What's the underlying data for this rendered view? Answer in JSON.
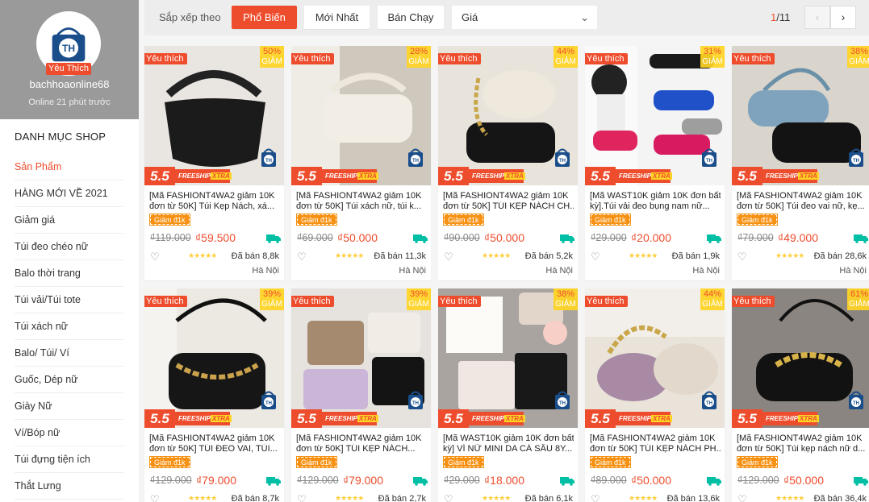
{
  "shop": {
    "favorite_badge": "Yêu Thích",
    "name": "bachhoaonline68",
    "online": "Online 21 phút trước"
  },
  "sidebar": {
    "title": "DANH MỤC SHOP",
    "items": [
      {
        "label": "Sản Phẩm",
        "active": true
      },
      {
        "label": "HÀNG MỚI VỀ 2021"
      },
      {
        "label": "Giảm giá"
      },
      {
        "label": "Túi đeo chéo nữ"
      },
      {
        "label": "Balo thời trang"
      },
      {
        "label": "Túi vải/Túi tote"
      },
      {
        "label": "Túi xách nữ"
      },
      {
        "label": "Balo/ Túi/ Ví"
      },
      {
        "label": "Guốc, Dép nữ"
      },
      {
        "label": "Giày Nữ"
      },
      {
        "label": "Ví/Bóp nữ"
      },
      {
        "label": "Túi đựng tiện ích"
      },
      {
        "label": "Thắt Lưng"
      }
    ]
  },
  "sortbar": {
    "label": "Sắp xếp theo",
    "options": [
      "Phổ Biến",
      "Mới Nhất",
      "Bán Chạy"
    ],
    "active": "Phổ Biến",
    "price_select": "Giá",
    "page_current": "1",
    "page_total": "/11"
  },
  "labels": {
    "favorite_tag": "Yêu thích",
    "discount_word": "GIẢM",
    "promo_55": "5.5",
    "freeship": "FREESHIP",
    "xtra": "XTRA",
    "coupon": "Giảm đ1k"
  },
  "colors": {
    "brand": "#ee4d2d",
    "discount_bg": "#ffd424",
    "coupon_bg": "#f69113"
  },
  "products": [
    {
      "discount": "50%",
      "title1": "[Mã FASHIONT4WA2 giảm 10K",
      "title2": "đơn từ 50K] Túi Kẹp Nách, xá...",
      "old_price": "₫119.000",
      "price": "₫59.500",
      "sold": "Đã bán 8,8k",
      "location": "Hà Nội",
      "img": "black-ruched"
    },
    {
      "discount": "28%",
      "title1": "[Mã FASHIONT4WA2 giảm 10K",
      "title2": "đơn từ 50K] Túi xách nữ, túi k...",
      "old_price": "₫69.000",
      "price": "₫50.000",
      "sold": "Đã bán 11,3k",
      "location": "Hà Nội",
      "img": "cream-baguette"
    },
    {
      "discount": "44%",
      "title1": "[Mã FASHIONT4WA2 giảm 10K",
      "title2": "đơn từ 50K] TÚI KẸP NÁCH CH...",
      "old_price": "₫90.000",
      "price": "₫50.000",
      "sold": "Đã bán 5,2k",
      "location": "Hà Nội",
      "img": "chain-pleated"
    },
    {
      "discount": "31%",
      "title1": "[Mã WAST10K giảm 10K đơn bất",
      "title2": "kỳ].Túi vải đeo bụng nam nữ...",
      "old_price": "₫29.000",
      "price": "₫20.000",
      "sold": "Đã bán 1,9k",
      "location": "Hà Nội",
      "img": "waist-bags"
    },
    {
      "discount": "38%",
      "title1": "[Mã FASHIONT4WA2 giảm 10K",
      "title2": "đơn từ 50K] Túi đeo vai nữ, kẹ...",
      "old_price": "₫79.000",
      "price": "₫49.000",
      "sold": "Đã bán 28,6k",
      "location": "Hà Nội",
      "img": "blue-black"
    },
    {
      "discount": "39%",
      "title1": "[Mã FASHIONT4WA2 giảm 10K",
      "title2": "đơn từ 50K] TÚI ĐEO VAI, TÚI...",
      "old_price": "₫129.000",
      "price": "₫79.000",
      "sold": "Đã bán 8,7k",
      "location": "",
      "img": "croc-chain"
    },
    {
      "discount": "39%",
      "title1": "[Mã FASHIONT4WA2 giảm 10K",
      "title2": "đơn từ 50K] TÚI KẸP NÁCH...",
      "old_price": "₫129.000",
      "price": "₫79.000",
      "sold": "Đã bán 2,7k",
      "location": "",
      "img": "multi-color"
    },
    {
      "discount": "38%",
      "title1": "[Mã WAST10K giảm 10K đơn bất",
      "title2": "kỳ] VÍ NỮ MINI DA CÁ SẤU 8Y...",
      "old_price": "₫29.000",
      "price": "₫18.000",
      "sold": "Đã bán 6,1k",
      "location": "",
      "img": "wallets"
    },
    {
      "discount": "44%",
      "title1": "[Mã FASHIONT4WA2 giảm 10K",
      "title2": "đơn từ 50K] TÚI KẸP NÁCH PH...",
      "old_price": "₫89.000",
      "price": "₫50.000",
      "sold": "Đã bán 13,6k",
      "location": "",
      "img": "glitter"
    },
    {
      "discount": "61%",
      "title1": "[Mã FASHIONT4WA2 giảm 10K",
      "title2": "đơn từ 50K] Túi kẹp nách nữ d...",
      "old_price": "₫129.000",
      "price": "₫50.000",
      "sold": "Đã bán 36,4k",
      "location": "",
      "img": "croc-gold"
    }
  ]
}
